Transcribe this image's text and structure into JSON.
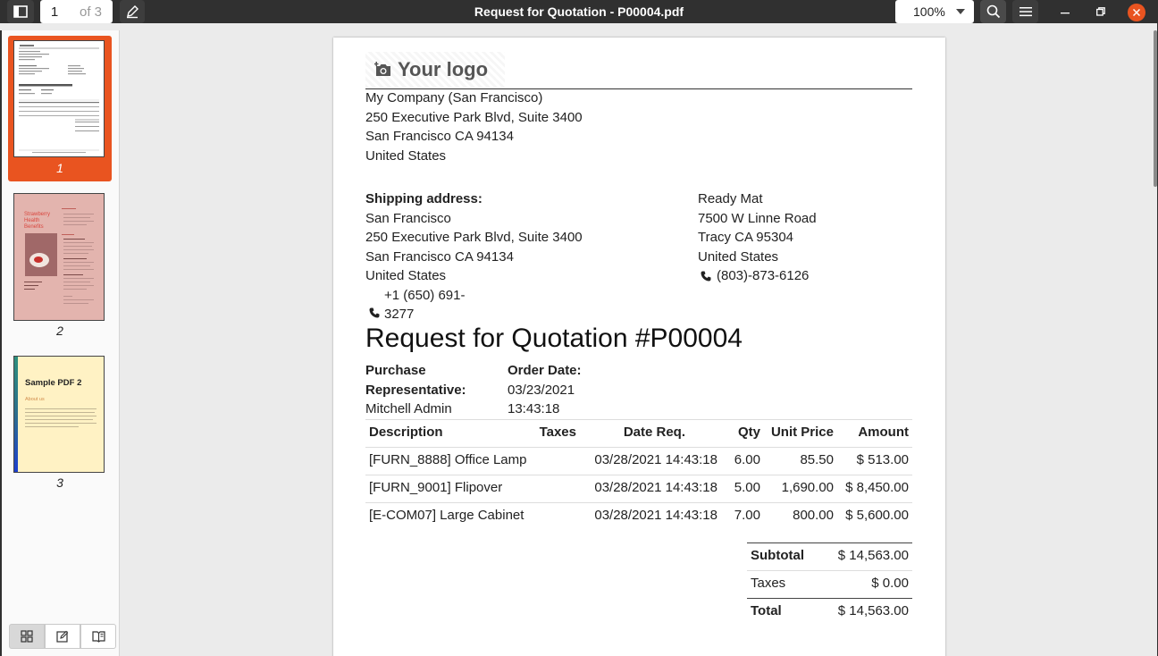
{
  "toolbar": {
    "current_page": "1",
    "page_count_label": "of 3",
    "title": "Request for Quotation - P00004.pdf",
    "zoom": "100%"
  },
  "sidebar": {
    "thumbnails": [
      {
        "label": "1"
      },
      {
        "label": "2"
      },
      {
        "label": "3"
      }
    ],
    "thumb3_title": "Sample PDF 2",
    "thumb3_subtitle": "About us",
    "thumb2_title": "Strawberry Health Benefits"
  },
  "doc": {
    "logo_text": "Your logo",
    "company": {
      "line1": "My Company (San Francisco)",
      "line2": "250 Executive Park Blvd, Suite 3400",
      "line3": "San Francisco CA 94134",
      "line4": "United States"
    },
    "shipping": {
      "heading": "Shipping address:",
      "line1": "San Francisco",
      "line2": "250 Executive Park Blvd, Suite 3400",
      "line3": "San Francisco CA 94134",
      "line4": "United States",
      "phone_a": "+1 (650) 691-",
      "phone_b": "3277"
    },
    "vendor": {
      "line1": "Ready Mat",
      "line2": "7500 W Linne Road",
      "line3": "Tracy CA 95304",
      "line4": "United States",
      "phone": "(803)-873-6126"
    },
    "rfq_title": "Request for Quotation #P00004",
    "purchase_rep_label_1": "Purchase",
    "purchase_rep_label_2": "Representative:",
    "purchase_rep_value": "Mitchell Admin",
    "order_date_label": "Order Date:",
    "order_date_value_1": "03/23/2021",
    "order_date_value_2": "13:43:18",
    "table": {
      "headers": [
        "Description",
        "Taxes",
        "Date Req.",
        "Qty",
        "Unit Price",
        "Amount"
      ],
      "rows": [
        {
          "description": "[FURN_8888] Office Lamp",
          "taxes": "",
          "date": "03/28/2021 14:43:18",
          "qty": "6.00",
          "unit_price": "85.50",
          "amount": "$ 513.00"
        },
        {
          "description": "[FURN_9001] Flipover",
          "taxes": "",
          "date": "03/28/2021 14:43:18",
          "qty": "5.00",
          "unit_price": "1,690.00",
          "amount": "$ 8,450.00"
        },
        {
          "description": "[E-COM07] Large Cabinet",
          "taxes": "",
          "date": "03/28/2021 14:43:18",
          "qty": "7.00",
          "unit_price": "800.00",
          "amount": "$ 5,600.00"
        }
      ]
    },
    "totals": {
      "subtotal_label": "Subtotal",
      "subtotal_value": "$ 14,563.00",
      "taxes_label": "Taxes",
      "taxes_value": "$ 0.00",
      "total_label": "Total",
      "total_value": "$ 14,563.00"
    }
  },
  "colors": {
    "accent": "#e95420",
    "header_bg": "#303030"
  }
}
